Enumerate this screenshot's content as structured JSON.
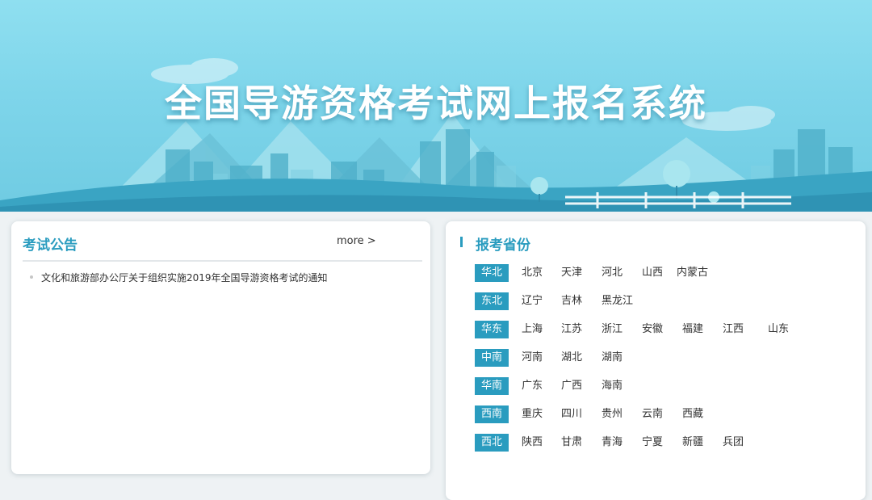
{
  "banner": {
    "title": "全国导游资格考试网上报名系统"
  },
  "notice": {
    "title": "考试公告",
    "more": "more >",
    "items": [
      "文化和旅游部办公厅关于组织实施2019年全国导游资格考试的通知"
    ]
  },
  "provinces": {
    "title": "报考省份",
    "regions": [
      {
        "name": "华北",
        "items": [
          "北京",
          "天津",
          "河北",
          "山西",
          "内蒙古"
        ]
      },
      {
        "name": "东北",
        "items": [
          "辽宁",
          "吉林",
          "黑龙江"
        ]
      },
      {
        "name": "华东",
        "items": [
          "上海",
          "江苏",
          "浙江",
          "安徽",
          "福建",
          "江西",
          "山东"
        ]
      },
      {
        "name": "中南",
        "items": [
          "河南",
          "湖北",
          "湖南"
        ]
      },
      {
        "name": "华南",
        "items": [
          "广东",
          "广西",
          "海南"
        ]
      },
      {
        "name": "西南",
        "items": [
          "重庆",
          "四川",
          "贵州",
          "云南",
          "西藏"
        ]
      },
      {
        "name": "西北",
        "items": [
          "陕西",
          "甘肃",
          "青海",
          "宁夏",
          "新疆",
          "兵团"
        ]
      }
    ]
  }
}
